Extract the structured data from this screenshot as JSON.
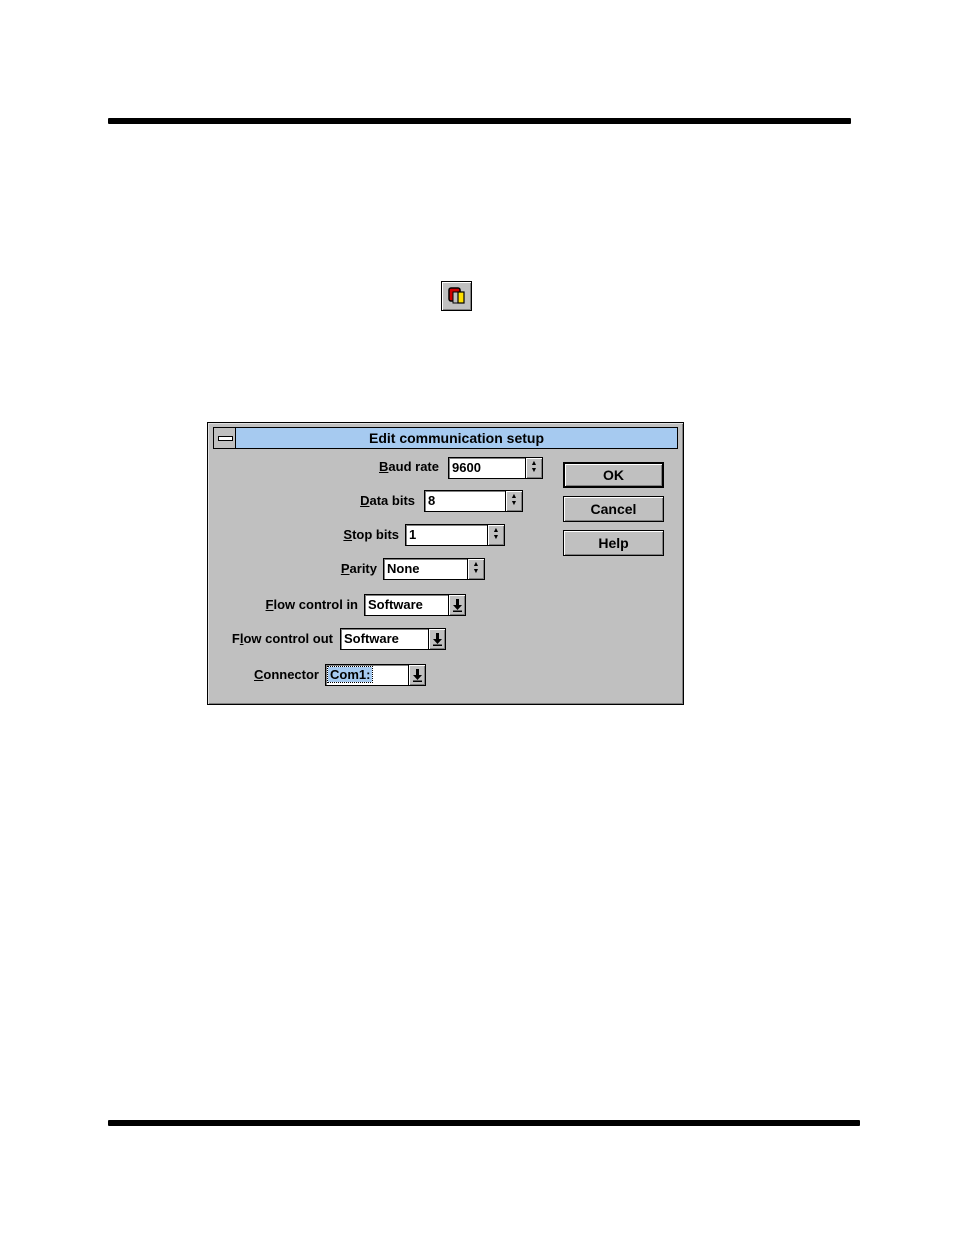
{
  "dialog": {
    "title": "Edit communication setup",
    "fields": {
      "baud_rate": {
        "label_accel": "B",
        "label_rest": "aud rate",
        "value": "9600"
      },
      "data_bits": {
        "label_accel": "D",
        "label_rest": "ata bits",
        "value": "8"
      },
      "stop_bits": {
        "label_accel": "S",
        "label_rest": "top bits",
        "value": "1"
      },
      "parity": {
        "label_accel": "P",
        "label_rest": "arity",
        "value": "None"
      },
      "flow_in": {
        "label_accel": "F",
        "label_rest": "low control in",
        "value": "Software"
      },
      "flow_out": {
        "label_pre": "F",
        "label_accel": "l",
        "label_rest": "ow control out",
        "value": "Software"
      },
      "connector": {
        "label_accel": "C",
        "label_rest": "onnector",
        "value": "Com1:"
      }
    },
    "buttons": {
      "ok": "OK",
      "cancel": "Cancel",
      "help": "Help"
    }
  },
  "icons": {
    "toolbar_button": "communication-setup-icon",
    "sysmenu": "system-menu-icon"
  },
  "colors": {
    "titlebar": "#a6caf0",
    "dialog_face": "#c0c0c0",
    "rule": "#000000"
  }
}
